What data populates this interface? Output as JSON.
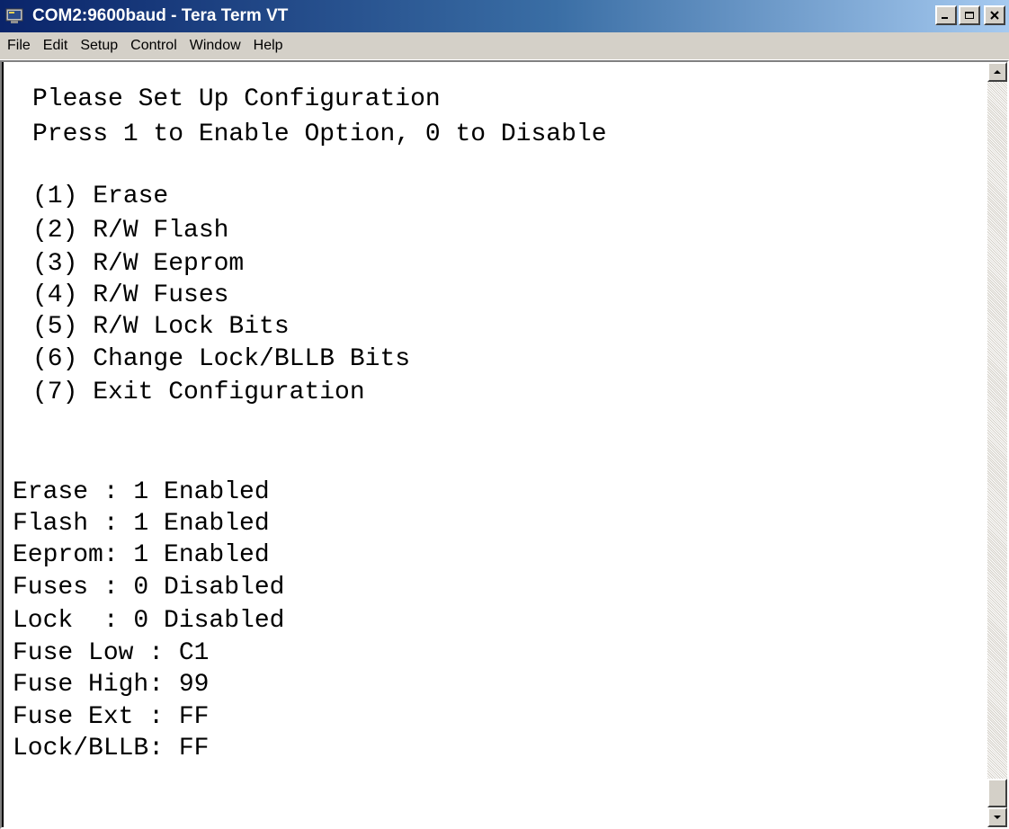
{
  "window": {
    "title": "COM2:9600baud - Tera Term VT",
    "title_bar_color": "#0a246a",
    "icons": {
      "app": "tera-term-icon",
      "minimize": "minimize-icon",
      "maximize": "maximize-icon",
      "close": "close-icon"
    }
  },
  "menu": {
    "items": [
      "File",
      "Edit",
      "Setup",
      "Control",
      "Window",
      "Help"
    ]
  },
  "terminal": {
    "header": [
      "Please Set Up Configuration",
      "Press 1 to Enable Option, 0 to Disable"
    ],
    "options": [
      "(1) Erase",
      "(2) R/W Flash",
      "(3) R/W Eeprom",
      "(4) R/W Fuses",
      "(5) R/W Lock Bits",
      "(6) Change Lock/BLLB Bits",
      "(7) Exit Configuration"
    ],
    "status": [
      "Erase : 1 Enabled",
      "Flash : 1 Enabled",
      "Eeprom: 1 Enabled",
      "Fuses : 0 Disabled",
      "Lock  : 0 Disabled",
      "Fuse Low : C1",
      "Fuse High: 99",
      "Fuse Ext : FF",
      "Lock/BLLB: FF"
    ]
  },
  "scrollbar": {
    "icons": {
      "up": "scroll-up-arrow-icon",
      "down": "scroll-down-arrow-icon"
    },
    "position": "bottom"
  }
}
